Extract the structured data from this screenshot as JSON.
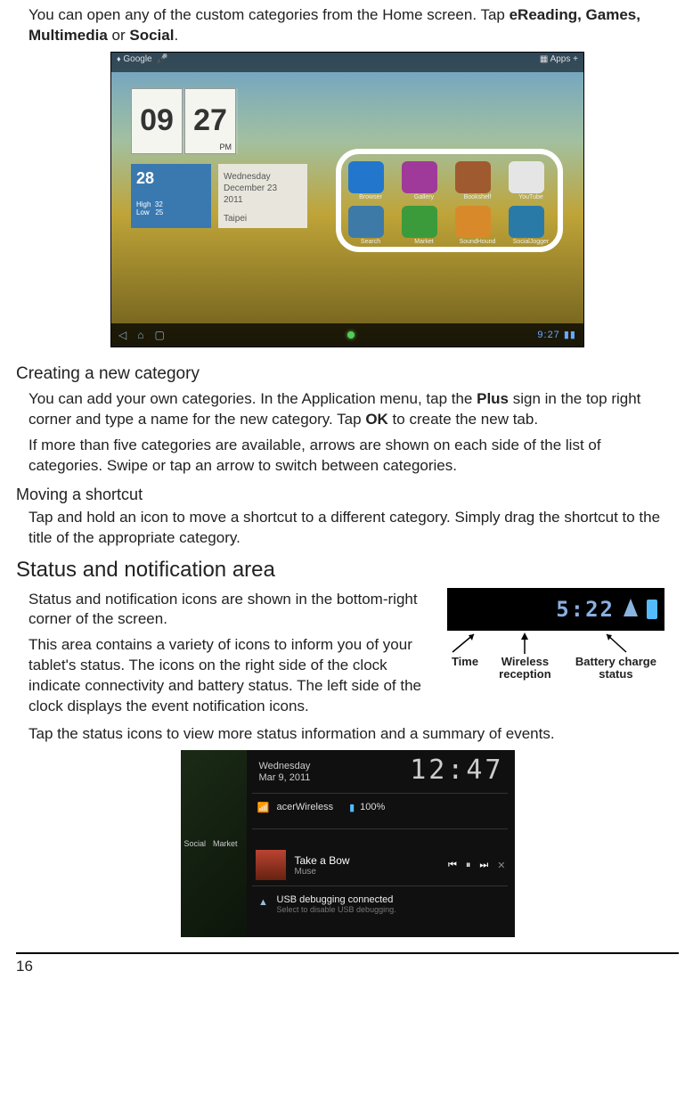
{
  "intro": "You can open any of the custom categories from the Home screen. Tap ",
  "intro_bold": "eReading, Games, Multimedia",
  "intro_mid": " or ",
  "intro_bold2": "Social",
  "intro_end": ".",
  "screenshot1": {
    "top_left": "Google",
    "top_right": "Apps  +",
    "clock_h": "09",
    "clock_m": "27",
    "pm": "PM",
    "weather_temp": "28",
    "weather_hl": "High  32\nLow   25",
    "date_day": "Wednesday",
    "date_full": "December 23",
    "date_year": "2011",
    "date_city": "Taipei",
    "apps": [
      {
        "name": "Browser",
        "color": "#2277cc"
      },
      {
        "name": "Gallery",
        "color": "#a03a9a"
      },
      {
        "name": "Bookshelf",
        "color": "#a05a2f"
      },
      {
        "name": "YouTube",
        "color": "#e5e5e5"
      },
      {
        "name": "Search",
        "color": "#3e7aa8"
      },
      {
        "name": "Market",
        "color": "#3b9b3b"
      },
      {
        "name": "SoundHound",
        "color": "#d88a2a"
      },
      {
        "name": "SocialJogger",
        "color": "#2a7aa8"
      }
    ],
    "bottom_time": "9:27"
  },
  "h_create": "Creating a new category",
  "p_create1a": "You can add your own categories. In the Application menu, tap the ",
  "p_create1_plus": "Plus",
  "p_create1b": " sign in the top right corner and type a name for the new category. Tap ",
  "p_create1_ok": "OK",
  "p_create1c": " to create the new tab.",
  "p_create2": "If more than five categories are available, arrows are shown on each side of the list of categories. Swipe or tap an arrow to switch between categories.",
  "h_move": "Moving a shortcut",
  "p_move": "Tap and hold an icon to move a shortcut to a different category. Simply drag the shortcut to the title of the appropriate category.",
  "h_status": "Status and notification area",
  "p_status1": "Status and notification icons are shown in the bottom-right corner of the screen.",
  "p_status2": "This area contains a variety of icons to inform you of your tablet's status. The icons on the right side of the clock indicate connectivity and battery status. The left side of the clock displays the event notification icons.",
  "p_status3": "Tap the status icons to view more status information and a summary of events.",
  "status_clock_time": "5:22",
  "callout_time": "Time",
  "callout_wifi": "Wireless reception",
  "callout_batt": "Battery charge status",
  "np": {
    "date_day": "Wednesday",
    "date_full": "Mar 9, 2011",
    "time": "12:47",
    "wifi_net": "acerWireless",
    "wifi_pct": "100%",
    "tab1": "Social",
    "tab2": "Market",
    "song": "Take a Bow",
    "artist": "Muse",
    "usb_title": "USB debugging connected",
    "usb_sub": "Select to disable USB debugging."
  },
  "page_number": "16"
}
